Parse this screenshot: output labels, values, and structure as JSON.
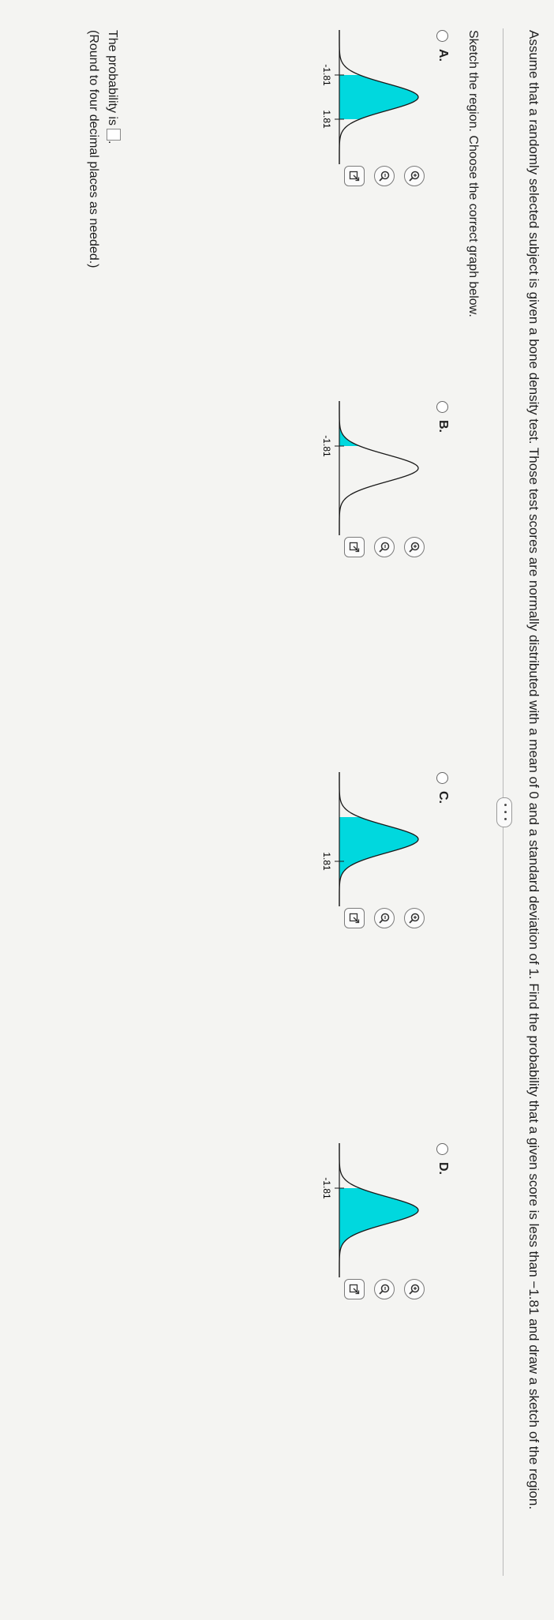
{
  "question": {
    "text": "Assume that a randomly selected subject is given a bone density test. Those test scores are normally distributed with a mean of 0 and a standard deviation of 1. Find the probability that a given score is less than −1.81 and draw a sketch of the region."
  },
  "more_button_label": "• • •",
  "instruction": "Sketch the region. Choose the correct graph below.",
  "options": [
    {
      "label": "A.",
      "shade": "between",
      "ticks": [
        "-1.81",
        "1.81"
      ],
      "selected": false
    },
    {
      "label": "B.",
      "shade": "left",
      "ticks": [
        "-1.81"
      ],
      "selected": false
    },
    {
      "label": "C.",
      "shade": "right",
      "ticks": [
        "1.81"
      ],
      "selected": false
    },
    {
      "label": "D.",
      "shade": "right",
      "ticks": [
        "-1.81"
      ],
      "selected": false
    }
  ],
  "colors": {
    "shade": "#00d8de",
    "curve": "#1a1a1a",
    "axis": "#1a1a1a"
  },
  "icons": [
    "zoom-in-icon",
    "zoom-out-icon",
    "popout-icon"
  ],
  "answer": {
    "prefix": "The probability is",
    "suffix": ".",
    "note": "(Round to four decimal places as needed.)",
    "value": ""
  }
}
